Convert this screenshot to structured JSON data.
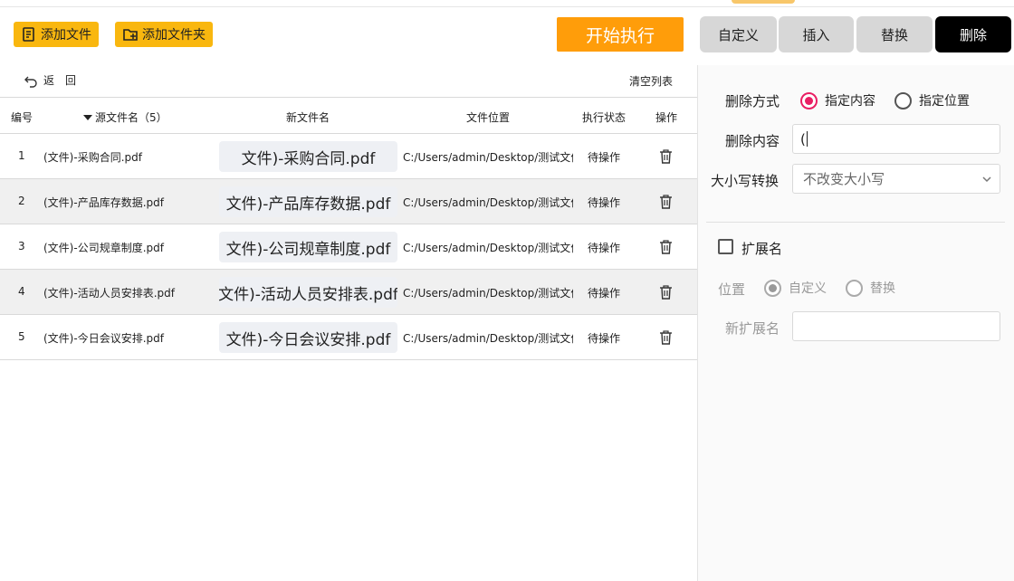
{
  "toolbar": {
    "add_file": "添加文件",
    "add_folder": "添加文件夹",
    "start": "开始执行"
  },
  "tabs": [
    "自定义",
    "插入",
    "替换",
    "删除"
  ],
  "active_tab": "删除",
  "list": {
    "back": "返　回",
    "clear": "清空列表",
    "headers": {
      "index": "编号",
      "source": "源文件名（5）",
      "new_name": "新文件名",
      "location": "文件位置",
      "status": "执行状态",
      "action": "操作"
    },
    "rows": [
      {
        "index": "1",
        "source": "(文件)-采购合同.pdf",
        "new_name": "文件)-采购合同.pdf",
        "location": "C:/Users/admin/Desktop/测试文件",
        "status": "待操作"
      },
      {
        "index": "2",
        "source": "(文件)-产品库存数据.pdf",
        "new_name": "文件)-产品库存数据.pdf",
        "location": "C:/Users/admin/Desktop/测试文件",
        "status": "待操作"
      },
      {
        "index": "3",
        "source": "(文件)-公司规章制度.pdf",
        "new_name": "文件)-公司规章制度.pdf",
        "location": "C:/Users/admin/Desktop/测试文件",
        "status": "待操作"
      },
      {
        "index": "4",
        "source": "(文件)-活动人员安排表.pdf",
        "new_name": "文件)-活动人员安排表.pdf",
        "location": "C:/Users/admin/Desktop/测试文件",
        "status": "待操作"
      },
      {
        "index": "5",
        "source": "(文件)-今日会议安排.pdf",
        "new_name": "文件)-今日会议安排.pdf",
        "location": "C:/Users/admin/Desktop/测试文件",
        "status": "待操作"
      }
    ]
  },
  "panel": {
    "delete_mode_label": "删除方式",
    "mode_options": [
      "指定内容",
      "指定位置"
    ],
    "mode_selected": "指定内容",
    "delete_content_label": "删除内容",
    "delete_content_value": "(",
    "case_label": "大小写转换",
    "case_value": "不改变大小写",
    "extension_label": "扩展名",
    "extension_checked": false,
    "position_label": "位置",
    "position_options": [
      "自定义",
      "替换"
    ],
    "position_selected": "自定义",
    "new_ext_label": "新扩展名",
    "new_ext_value": ""
  },
  "colors": {
    "add_button": "#f9b70f",
    "start_button": "#ff9d0a",
    "tab_active": "#000000",
    "tab_inactive": "#d7d7d7",
    "radio_checked": "#e91e63"
  },
  "icons": {
    "add_file": "document-list-icon",
    "add_folder": "folder-plus-icon",
    "back": "undo-arrow-icon",
    "sort": "caret-down-icon",
    "delete": "trash-icon",
    "dropdown": "chevron-down-icon"
  }
}
